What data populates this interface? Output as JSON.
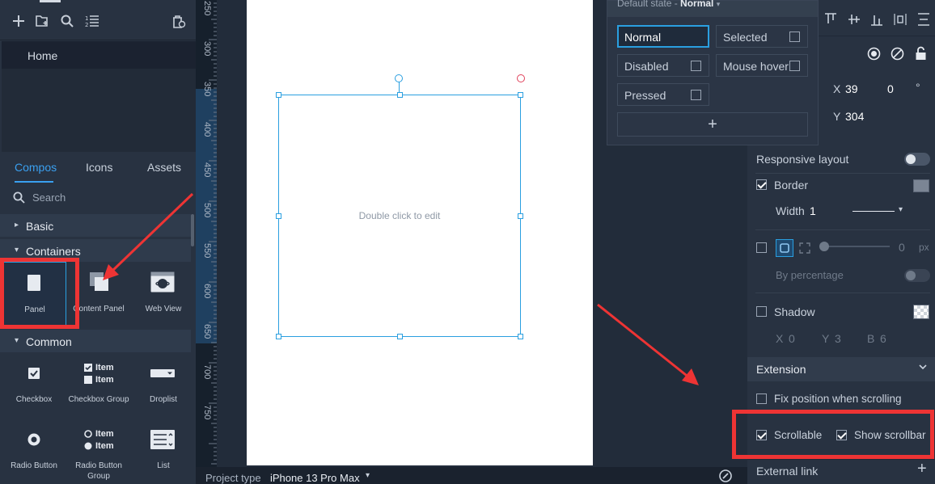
{
  "toolbar": {
    "icons": [
      "plus-icon",
      "add-folder-icon",
      "search-icon",
      "sort-list-icon",
      "delete-icon"
    ]
  },
  "pages": {
    "home": "Home"
  },
  "library": {
    "tabs": [
      "Compos",
      "Icons",
      "Assets"
    ],
    "search_placeholder": "Search",
    "categories": {
      "basic": "Basic",
      "containers": "Containers",
      "common": "Common"
    },
    "containers": [
      "Panel",
      "Content Panel",
      "Web View"
    ],
    "common": [
      "Checkbox",
      "Checkbox Group",
      "Droplist",
      "Radio Button",
      "Radio Button Group",
      "List"
    ],
    "checkbox_group_items": [
      "Item",
      "Item"
    ],
    "radio_group_items": [
      "Item",
      "Item"
    ]
  },
  "ruler": {
    "labels": [
      "250",
      "300",
      "350",
      "400",
      "450",
      "500",
      "550",
      "600",
      "650",
      "700",
      "750"
    ]
  },
  "canvas": {
    "hint": "Double click to edit"
  },
  "bottom": {
    "project_type_label": "Project type",
    "device": "iPhone 13 Pro Max"
  },
  "states": {
    "header_label": "Default state - ",
    "header_value": "Normal",
    "items": [
      "Normal",
      "Selected",
      "Disabled",
      "Mouse hover",
      "Pressed"
    ],
    "add": "+"
  },
  "inspector": {
    "x_label": "X",
    "x_value": "39",
    "angle_value": "0",
    "angle_unit": "°",
    "y_label": "Y",
    "y_value": "304",
    "responsive_layout": "Responsive layout",
    "border": "Border",
    "width_label": "Width",
    "width_value": "1",
    "radius_value": "0",
    "radius_unit": "px",
    "by_percentage": "By percentage",
    "shadow": "Shadow",
    "shadow_x_label": "X",
    "shadow_x": "0",
    "shadow_y_label": "Y",
    "shadow_y": "3",
    "shadow_b_label": "B",
    "shadow_b": "6",
    "extension": "Extension",
    "fix_position": "Fix position when scrolling",
    "scrollable": "Scrollable",
    "show_scrollbar": "Show scrollbar",
    "external_link": "External link",
    "add_link": "+"
  },
  "colors": {
    "accent": "#2a9fe0",
    "annotation": "#ee3434",
    "panel_bg": "#283241"
  }
}
